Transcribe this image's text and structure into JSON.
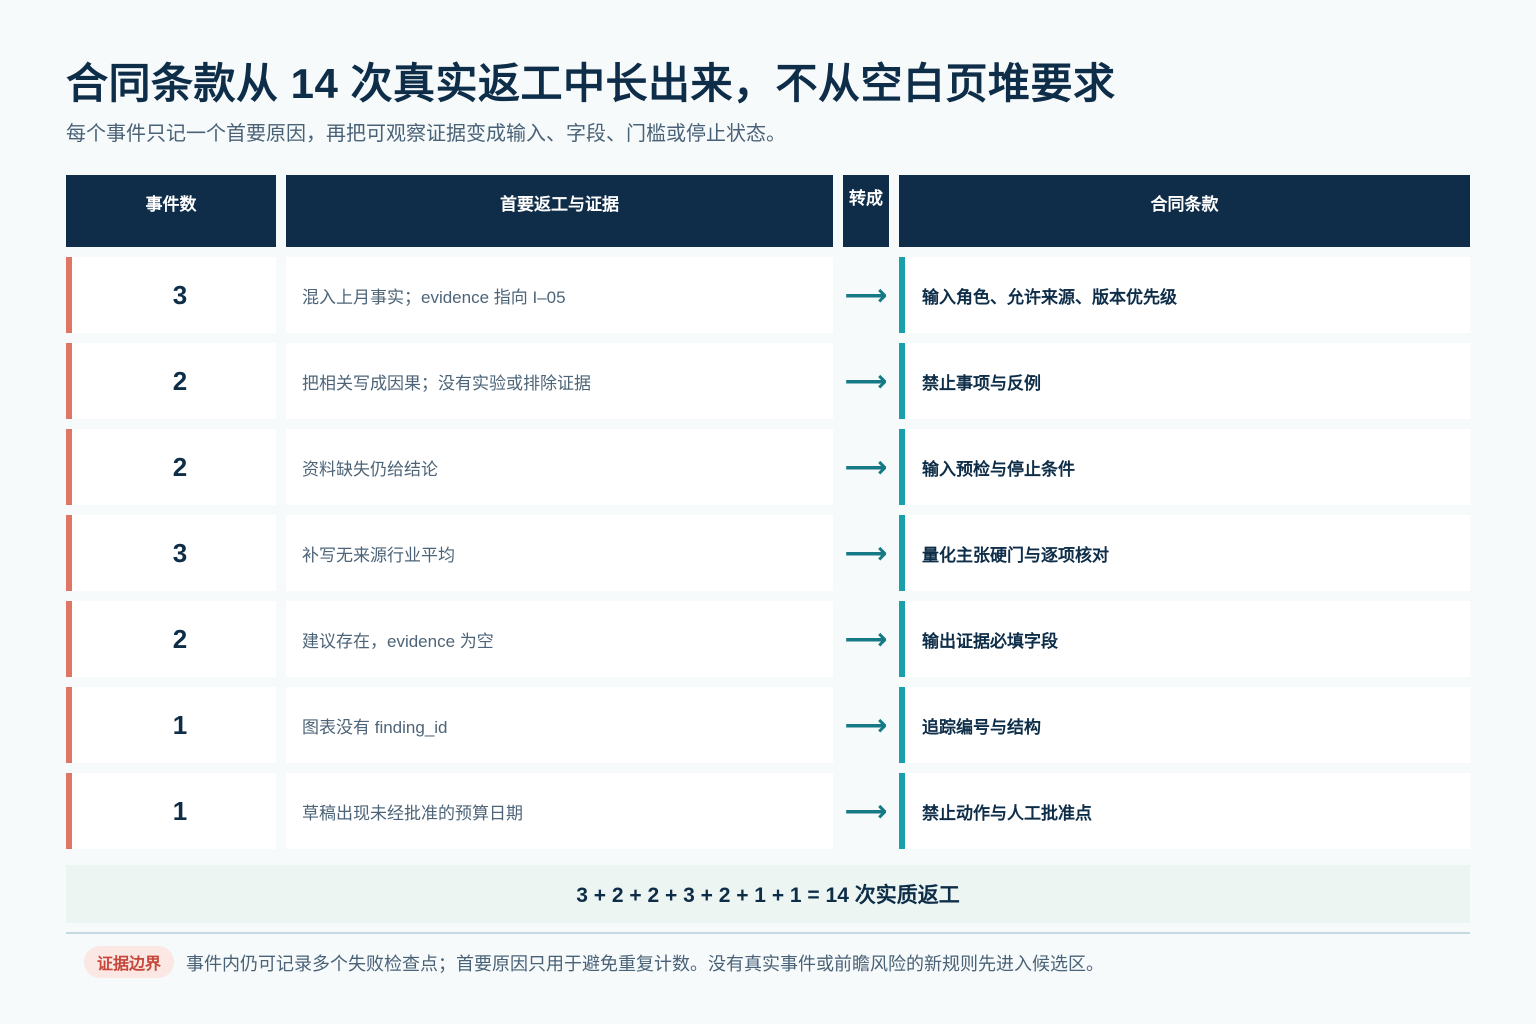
{
  "title": "合同条款从 14 次真实返工中长出来，不从空白页堆要求",
  "subtitle": "每个事件只记一个首要原因，再把可观察证据变成输入、字段、门槛或停止状态。",
  "table": {
    "headers": {
      "count": "事件数",
      "rework": "首要返工与证据",
      "arrow_line1": "转",
      "arrow_line2": "成",
      "clause": "合同条款"
    },
    "arrow_glyph": "⟶",
    "rows": [
      {
        "count": "3",
        "rework": "混入上月事实；evidence 指向 I–05",
        "clause": "输入角色、允许来源、版本优先级"
      },
      {
        "count": "2",
        "rework": "把相关写成因果；没有实验或排除证据",
        "clause": "禁止事项与反例"
      },
      {
        "count": "2",
        "rework": "资料缺失仍给结论",
        "clause": "输入预检与停止条件"
      },
      {
        "count": "3",
        "rework": "补写无来源行业平均",
        "clause": "量化主张硬门与逐项核对"
      },
      {
        "count": "2",
        "rework": "建议存在，evidence 为空",
        "clause": "输出证据必填字段"
      },
      {
        "count": "1",
        "rework": "图表没有 finding_id",
        "clause": "追踪编号与结构"
      },
      {
        "count": "1",
        "rework": "草稿出现未经批准的预算日期",
        "clause": "禁止动作与人工批准点"
      }
    ]
  },
  "total": "3 + 2 + 2 + 3 + 2 + 1 + 1 = 14 次实质返工",
  "footer": {
    "badge": "证据边界",
    "note": "事件内仍可记录多个失败检查点；首要原因只用于避免重复计数。没有真实事件或前瞻风险的新规则先进入候选区。"
  },
  "colors": {
    "header_bg": "#0f2d48",
    "count_accent": "#e07566",
    "clause_accent": "#1aa0ab",
    "arrow": "#157a86",
    "badge_bg": "#fbe7e3",
    "badge_text": "#c5473a"
  }
}
